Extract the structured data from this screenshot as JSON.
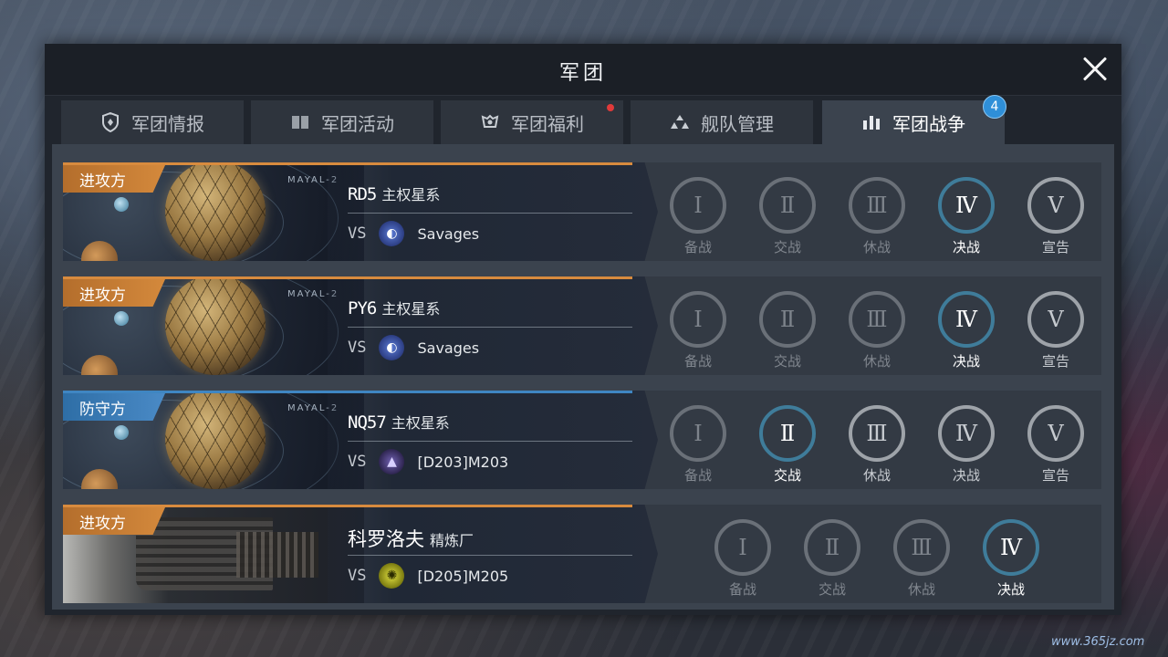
{
  "window": {
    "title": "军团",
    "close_label": "close"
  },
  "tabs": [
    {
      "label": "军团情报",
      "icon": "shield-icon",
      "active": false
    },
    {
      "label": "军团活动",
      "icon": "book-icon",
      "active": false,
      "red_dot": false
    },
    {
      "label": "军团福利",
      "icon": "gift-icon",
      "active": false,
      "red_dot": true
    },
    {
      "label": "舰队管理",
      "icon": "fleet-icon",
      "active": false
    },
    {
      "label": "军团战争",
      "icon": "war-icon",
      "active": true,
      "badge": "4"
    }
  ],
  "wars": [
    {
      "role": "进攻方",
      "role_type": "attack",
      "code": "RD5",
      "system_type": "主权星系",
      "opponent": "Savages",
      "phases": [
        {
          "numeral": "Ⅰ",
          "label": "备战",
          "state": "dim"
        },
        {
          "numeral": "Ⅱ",
          "label": "交战",
          "state": "dim"
        },
        {
          "numeral": "Ⅲ",
          "label": "休战",
          "state": "dim"
        },
        {
          "numeral": "Ⅳ",
          "label": "决战",
          "state": "current"
        },
        {
          "numeral": "Ⅴ",
          "label": "宣告",
          "state": "done"
        }
      ]
    },
    {
      "role": "进攻方",
      "role_type": "attack",
      "code": "PY6",
      "system_type": "主权星系",
      "opponent": "Savages",
      "phases": [
        {
          "numeral": "Ⅰ",
          "label": "备战",
          "state": "dim"
        },
        {
          "numeral": "Ⅱ",
          "label": "交战",
          "state": "dim"
        },
        {
          "numeral": "Ⅲ",
          "label": "休战",
          "state": "dim"
        },
        {
          "numeral": "Ⅳ",
          "label": "决战",
          "state": "current"
        },
        {
          "numeral": "Ⅴ",
          "label": "宣告",
          "state": "done"
        }
      ]
    },
    {
      "role": "防守方",
      "role_type": "defend",
      "code": "NQ57",
      "system_type": "主权星系",
      "opponent": "[D203]M203",
      "phases": [
        {
          "numeral": "Ⅰ",
          "label": "备战",
          "state": "dim"
        },
        {
          "numeral": "Ⅱ",
          "label": "交战",
          "state": "current"
        },
        {
          "numeral": "Ⅲ",
          "label": "休战",
          "state": "done"
        },
        {
          "numeral": "Ⅳ",
          "label": "决战",
          "state": "done"
        },
        {
          "numeral": "Ⅴ",
          "label": "宣告",
          "state": "done"
        }
      ]
    },
    {
      "role": "进攻方",
      "role_type": "attack",
      "name": "科罗洛夫",
      "system_type": "精炼厂",
      "opponent": "[D205]M205",
      "phases": [
        {
          "numeral": "Ⅰ",
          "label": "备战",
          "state": "dim"
        },
        {
          "numeral": "Ⅱ",
          "label": "交战",
          "state": "dim"
        },
        {
          "numeral": "Ⅲ",
          "label": "休战",
          "state": "dim"
        },
        {
          "numeral": "Ⅳ",
          "label": "决战",
          "state": "current"
        }
      ]
    }
  ],
  "planet_label": "MAYAL-2",
  "vs_label": "VS",
  "watermark": "www.365jz.com"
}
